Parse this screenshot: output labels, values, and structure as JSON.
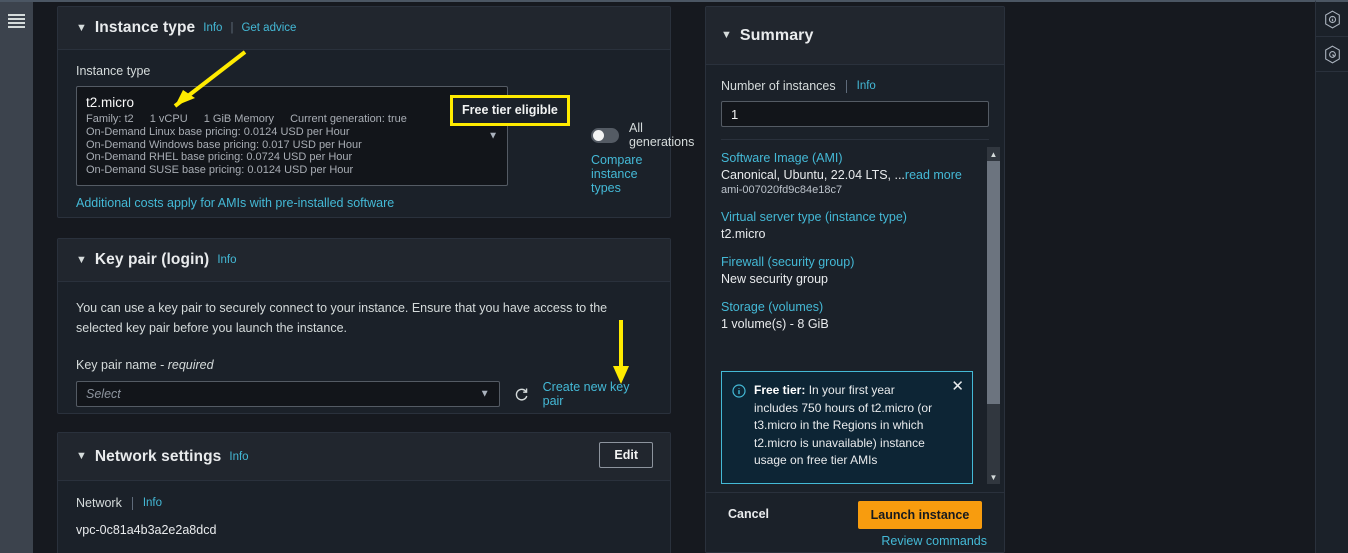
{
  "nav": {
    "menu_icon": "hamburger-menu-icon"
  },
  "right_rail": [
    {
      "icon": "info-hexagon-icon",
      "name": "information-panel"
    },
    {
      "icon": "settings-hexagon-icon",
      "name": "settings-panel"
    }
  ],
  "instance_type_panel": {
    "title": "Instance type",
    "info_link": "Info",
    "pipe": "|",
    "advice_link": "Get advice",
    "field_label": "Instance type",
    "selected": {
      "name": "t2.micro",
      "family": "Family: t2",
      "vcpu": "1 vCPU",
      "memory": "1 GiB Memory",
      "generation": "Current generation: true",
      "pricing_linux": "On-Demand Linux base pricing: 0.0124 USD per Hour",
      "pricing_windows": "On-Demand Windows base pricing: 0.017 USD per Hour",
      "pricing_rhel": "On-Demand RHEL base pricing: 0.0724 USD per Hour",
      "pricing_suse": "On-Demand SUSE base pricing: 0.0124 USD per Hour"
    },
    "free_tier_badge": "Free tier eligible",
    "all_generations_label": "All generations",
    "all_generations_on": false,
    "compare_link": "Compare instance types",
    "additional_costs_link": "Additional costs apply for AMIs with pre-installed software"
  },
  "key_pair_panel": {
    "title": "Key pair (login)",
    "info_link": "Info",
    "description": "You can use a key pair to securely connect to your instance. Ensure that you have access to the selected key pair before you launch the instance.",
    "field_label": "Key pair name -",
    "field_label_required": "required",
    "select_placeholder": "Select",
    "refresh_icon": "refresh-icon",
    "create_link": "Create new key pair"
  },
  "network_panel": {
    "title": "Network settings",
    "info_link": "Info",
    "edit_label": "Edit",
    "network_label": "Network",
    "network_info_link": "Info",
    "network_value": "vpc-0c81a4b3a2e2a8dcd"
  },
  "summary_panel": {
    "title": "Summary",
    "instances_label": "Number of instances",
    "instances_info": "Info",
    "instances_value": "1",
    "groups": [
      {
        "key": "Software Image (AMI)",
        "value": "Canonical, Ubuntu, 22.04 LTS, ...",
        "value_link": "read more",
        "sub": "ami-007020fd9c84e18c7"
      },
      {
        "key": "Virtual server type (instance type)",
        "value": "t2.micro",
        "value_link": "",
        "sub": ""
      },
      {
        "key": "Firewall (security group)",
        "value": "New security group",
        "value_link": "",
        "sub": ""
      },
      {
        "key": "Storage (volumes)",
        "value": "1 volume(s) - 8 GiB",
        "value_link": "",
        "sub": ""
      }
    ],
    "callout": {
      "icon": "info-circle-icon",
      "bold_prefix": "Free tier:",
      "text": " In your first year includes 750 hours of t2.micro (or t3.micro in the Regions in which t2.micro is unavailable) instance usage on free tier AMIs",
      "close_icon": "close-icon"
    },
    "footer": {
      "cancel_label": "Cancel",
      "launch_label": "Launch instance",
      "review_label": "Review commands"
    }
  },
  "annotations": {
    "arrow_instance_type": "yellow-arrow-pointing-to-instance-type",
    "arrow_create_key_pair": "yellow-arrow-pointing-to-create-new-key-pair",
    "highlight_free_tier": "yellow-box-around-free-tier-eligible"
  },
  "colors": {
    "accent_link": "#44b9d6",
    "annotation_yellow": "#ffeb00",
    "launch_orange": "#f89c0e",
    "panel_bg": "#1b2129",
    "page_bg": "#16191f"
  }
}
